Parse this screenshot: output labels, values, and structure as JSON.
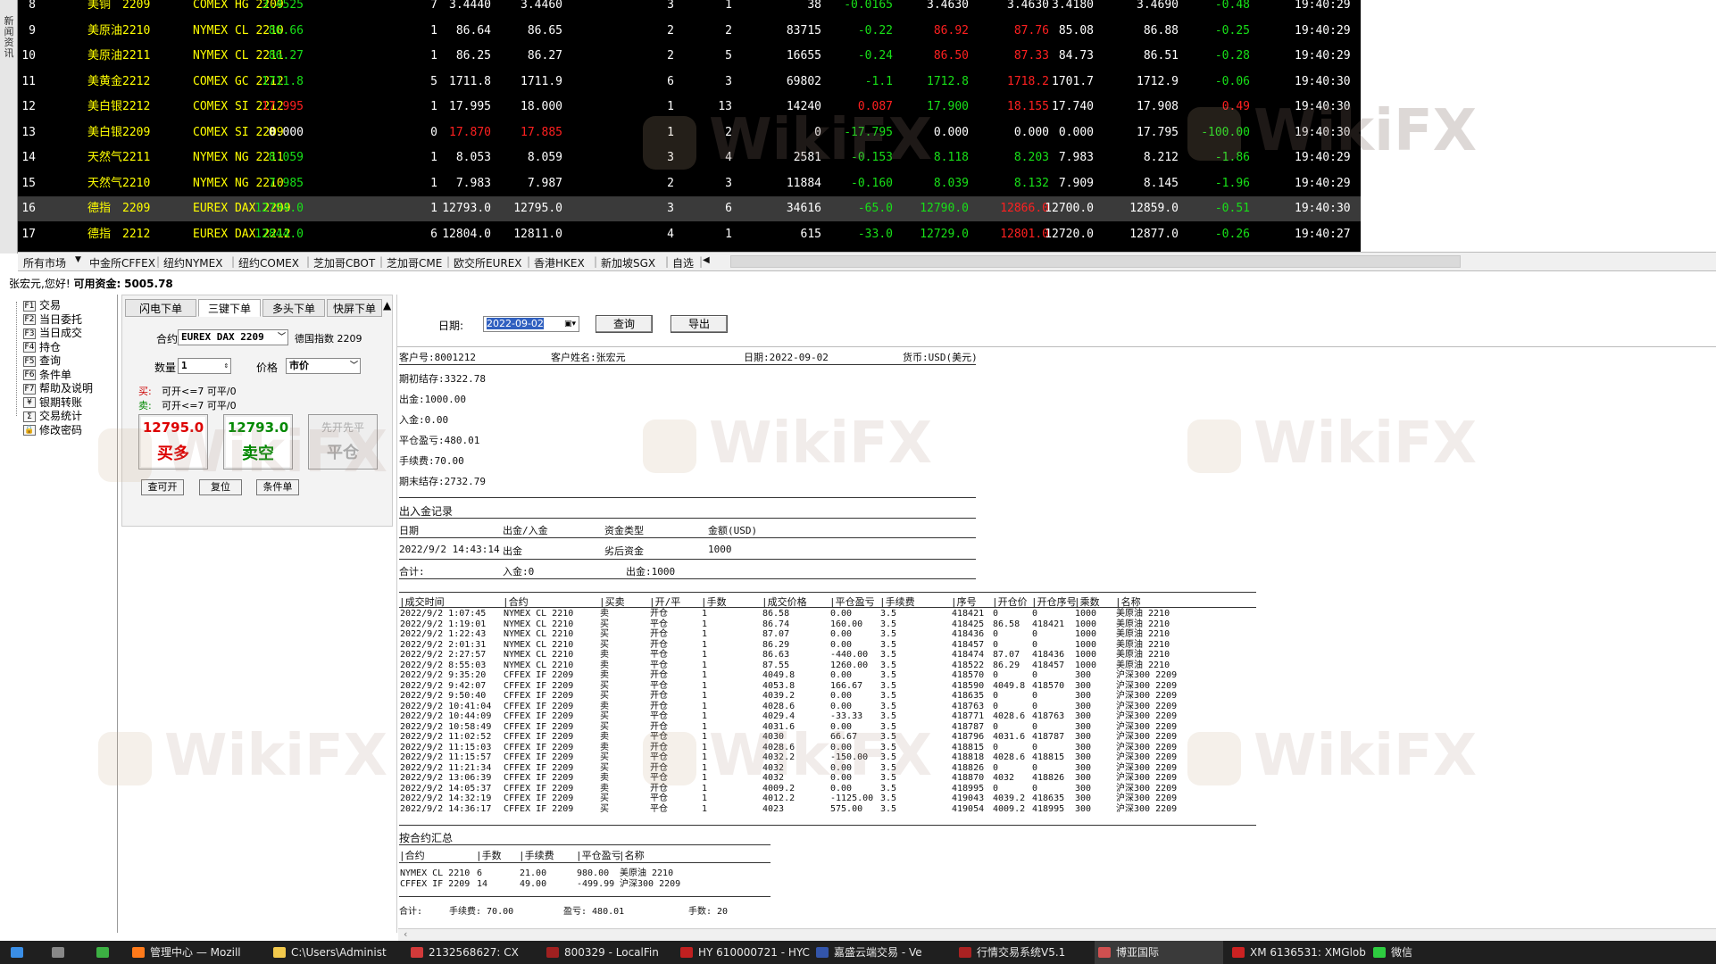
{
  "side_strip": {
    "label": "新闻资讯"
  },
  "quotes": [
    {
      "no": "8",
      "name": "美铜",
      "month": "2209",
      "contract": "COMEX HG 2209",
      "last": "3.4525",
      "lastc": "c-g",
      "vol": "7",
      "bid": "3.4440",
      "ask": "3.4460",
      "bidv": "3",
      "askv": "1",
      "tvol": "38",
      "chg": "-0.0165",
      "chgc": "c-g",
      "open": "3.4630",
      "openc": "c-w",
      "high": "3.4630",
      "highc": "c-w",
      "low": "3.4180",
      "pre": "3.4690",
      "pct": "-0.48",
      "pctc": "c-g",
      "time": "19:40:29"
    },
    {
      "no": "9",
      "name": "美原油",
      "month": "2210",
      "contract": "NYMEX CL 2210",
      "last": "86.66",
      "lastc": "c-g",
      "vol": "1",
      "bid": "86.64",
      "ask": "86.65",
      "bidv": "2",
      "askv": "2",
      "tvol": "83715",
      "chg": "-0.22",
      "chgc": "c-g",
      "open": "86.92",
      "openc": "c-r",
      "high": "87.76",
      "highc": "c-r",
      "low": "85.08",
      "pre": "86.88",
      "pct": "-0.25",
      "pctc": "c-g",
      "time": "19:40:29"
    },
    {
      "no": "10",
      "name": "美原油",
      "month": "2211",
      "contract": "NYMEX CL 2211",
      "last": "86.27",
      "lastc": "c-g",
      "vol": "1",
      "bid": "86.25",
      "ask": "86.27",
      "bidv": "2",
      "askv": "5",
      "tvol": "16655",
      "chg": "-0.24",
      "chgc": "c-g",
      "open": "86.50",
      "openc": "c-r",
      "high": "87.33",
      "highc": "c-r",
      "low": "84.73",
      "pre": "86.51",
      "pct": "-0.28",
      "pctc": "c-g",
      "time": "19:40:29"
    },
    {
      "no": "11",
      "name": "美黄金",
      "month": "2212",
      "contract": "COMEX GC 2212",
      "last": "1711.8",
      "lastc": "c-g",
      "vol": "5",
      "bid": "1711.8",
      "ask": "1711.9",
      "bidv": "6",
      "askv": "3",
      "tvol": "69802",
      "chg": "-1.1",
      "chgc": "c-g",
      "open": "1712.8",
      "openc": "c-g",
      "high": "1718.2",
      "highc": "c-r",
      "low": "1701.7",
      "pre": "1712.9",
      "pct": "-0.06",
      "pctc": "c-g",
      "time": "19:40:30"
    },
    {
      "no": "12",
      "name": "美白银",
      "month": "2212",
      "contract": "COMEX SI 2212",
      "last": "17.995",
      "lastc": "c-r",
      "vol": "1",
      "bid": "17.995",
      "ask": "18.000",
      "bidv": "1",
      "askv": "13",
      "tvol": "14240",
      "chg": "0.087",
      "chgc": "c-r",
      "open": "17.900",
      "openc": "c-g",
      "high": "18.155",
      "highc": "c-r",
      "low": "17.740",
      "pre": "17.908",
      "pct": "0.49",
      "pctc": "c-r",
      "time": "19:40:30"
    },
    {
      "no": "13",
      "name": "美白银",
      "month": "2209",
      "contract": "COMEX SI 2209",
      "last": "0.000",
      "lastc": "c-w",
      "vol": "0",
      "bid": "17.870",
      "ask": "17.885",
      "bidv": "1",
      "askv": "2",
      "tvol": "0",
      "chg": "-17.795",
      "chgc": "c-g",
      "open": "0.000",
      "openc": "c-w",
      "high": "0.000",
      "highc": "c-w",
      "low": "0.000",
      "pre": "17.795",
      "pct": "-100.00",
      "pctc": "c-g",
      "time": "19:40:30",
      "redbid": true
    },
    {
      "no": "14",
      "name": "天然气",
      "month": "2211",
      "contract": "NYMEX NG 2211",
      "last": "8.059",
      "lastc": "c-g",
      "vol": "1",
      "bid": "8.053",
      "ask": "8.059",
      "bidv": "3",
      "askv": "4",
      "tvol": "2581",
      "chg": "-0.153",
      "chgc": "c-g",
      "open": "8.118",
      "openc": "c-g",
      "high": "8.203",
      "highc": "c-g",
      "low": "7.983",
      "pre": "8.212",
      "pct": "-1.86",
      "pctc": "c-g",
      "time": "19:40:29"
    },
    {
      "no": "15",
      "name": "天然气",
      "month": "2210",
      "contract": "NYMEX NG 2210",
      "last": "7.985",
      "lastc": "c-g",
      "vol": "1",
      "bid": "7.983",
      "ask": "7.987",
      "bidv": "2",
      "askv": "3",
      "tvol": "11884",
      "chg": "-0.160",
      "chgc": "c-g",
      "open": "8.039",
      "openc": "c-g",
      "high": "8.132",
      "highc": "c-g",
      "low": "7.909",
      "pre": "8.145",
      "pct": "-1.96",
      "pctc": "c-g",
      "time": "19:40:29"
    },
    {
      "no": "16",
      "name": "德指",
      "month": "2209",
      "contract": "EUREX DAX 2209",
      "last": "12794.0",
      "lastc": "c-g",
      "vol": "1",
      "bid": "12793.0",
      "ask": "12795.0",
      "bidv": "3",
      "askv": "6",
      "tvol": "34616",
      "chg": "-65.0",
      "chgc": "c-g",
      "open": "12790.0",
      "openc": "c-g",
      "high": "12866.0",
      "highc": "c-r",
      "low": "12700.0",
      "pre": "12859.0",
      "pct": "-0.51",
      "pctc": "c-g",
      "time": "19:40:30",
      "sel": true
    },
    {
      "no": "17",
      "name": "德指",
      "month": "2212",
      "contract": "EUREX DAX 2212",
      "last": "12844.0",
      "lastc": "c-g",
      "vol": "6",
      "bid": "12804.0",
      "ask": "12811.0",
      "bidv": "4",
      "askv": "1",
      "tvol": "615",
      "chg": "-33.0",
      "chgc": "c-g",
      "open": "12729.0",
      "openc": "c-g",
      "high": "12801.0",
      "highc": "c-r",
      "low": "12720.0",
      "pre": "12877.0",
      "pct": "-0.26",
      "pctc": "c-g",
      "time": "19:40:27"
    }
  ],
  "market_tabs": [
    "所有市场",
    "中金所CFFEX",
    "纽约NYMEX",
    "纽约COMEX",
    "芝加哥CBOT",
    "芝加哥CME",
    "欧交所EUREX",
    "香港HKEX",
    "新加坡SGX",
    "自选"
  ],
  "account_bar": {
    "greeting": "张宏元,您好!",
    "funds_label": "可用资金:",
    "funds": "5005.78"
  },
  "nav": [
    {
      "key": "F1",
      "label": "交易"
    },
    {
      "key": "F2",
      "label": "当日委托"
    },
    {
      "key": "F3",
      "label": "当日成交"
    },
    {
      "key": "F4",
      "label": "持仓"
    },
    {
      "key": "F5",
      "label": "查询"
    },
    {
      "key": "F6",
      "label": "条件单"
    },
    {
      "key": "F7",
      "label": "帮助及说明"
    },
    {
      "key": "¥",
      "label": "银期转账"
    },
    {
      "key": "Σ",
      "label": "交易统计"
    },
    {
      "key": "🔒",
      "label": "修改密码"
    }
  ],
  "order": {
    "tabs": [
      "闪电下单",
      "三键下单",
      "多头下单",
      "快屏下单"
    ],
    "contract_label": "合约",
    "contract_value": "EUREX DAX 2209",
    "contract_name": "德国指数 2209",
    "qty_label": "数量",
    "qty_value": "1",
    "price_label": "价格",
    "price_value": "市价",
    "buy_tag": "买:",
    "buy_info": "可开<=7 可平/0",
    "sell_tag": "卖:",
    "sell_info": "可开<=7 可平/0",
    "buy_price": "12795.0",
    "buy_action": "买多",
    "sell_price": "12793.0",
    "sell_action": "卖空",
    "close_top": "先开先平",
    "close_action": "平仓",
    "btn_query": "查可开",
    "btn_reset": "复位",
    "btn_cond": "条件单"
  },
  "toolbar": {
    "date_label": "日期:",
    "date_value": "2022-09-02",
    "query": "查询",
    "export": "导出"
  },
  "statement": {
    "client_no": "客户号:8001212",
    "client_name": "客户姓名:张宏元",
    "date": "日期:2022-09-02",
    "currency": "货币:USD(美元)",
    "lines": [
      "期初结存:3322.78",
      "出金:1000.00",
      "入金:0.00",
      "平仓盈亏:480.01",
      "手续费:70.00",
      "期末结存:2732.79"
    ],
    "cash_title": "出入金记录",
    "cash_headers": [
      "日期",
      "出金/入金",
      "资金类型",
      "金额(USD)"
    ],
    "cash_row": [
      "2022/9/2 14:43:14",
      "出金",
      "劣后资金",
      "1000"
    ],
    "cash_total": [
      "合计:",
      "入金:0",
      "出金:1000"
    ],
    "trade_headers": [
      "|成交时间",
      "|合约",
      "|买卖",
      "|开/平",
      "|手数",
      "|成交价格",
      "|平仓盈亏",
      "|手续费",
      "|序号",
      "|开仓价",
      "|开仓序号",
      "|乘数",
      "|名称"
    ],
    "trades": [
      [
        "2022/9/2 1:07:45",
        "NYMEX CL 2210",
        "卖",
        "开仓",
        "1",
        "86.58",
        "0.00",
        "3.5",
        "418421",
        "0",
        "0",
        "1000",
        "美原油 2210"
      ],
      [
        "2022/9/2 1:19:01",
        "NYMEX CL 2210",
        "买",
        "平仓",
        "1",
        "86.74",
        "160.00",
        "3.5",
        "418425",
        "86.58",
        "418421",
        "1000",
        "美原油 2210"
      ],
      [
        "2022/9/2 1:22:43",
        "NYMEX CL 2210",
        "买",
        "开仓",
        "1",
        "87.07",
        "0.00",
        "3.5",
        "418436",
        "0",
        "0",
        "1000",
        "美原油 2210"
      ],
      [
        "2022/9/2 2:01:31",
        "NYMEX CL 2210",
        "买",
        "开仓",
        "1",
        "86.29",
        "0.00",
        "3.5",
        "418457",
        "0",
        "0",
        "1000",
        "美原油 2210"
      ],
      [
        "2022/9/2 2:27:57",
        "NYMEX CL 2210",
        "卖",
        "平仓",
        "1",
        "86.63",
        "-440.00",
        "3.5",
        "418474",
        "87.07",
        "418436",
        "1000",
        "美原油 2210"
      ],
      [
        "2022/9/2 8:55:03",
        "NYMEX CL 2210",
        "卖",
        "平仓",
        "1",
        "87.55",
        "1260.00",
        "3.5",
        "418522",
        "86.29",
        "418457",
        "1000",
        "美原油 2210"
      ],
      [
        "2022/9/2 9:35:20",
        "CFFEX IF 2209",
        "卖",
        "开仓",
        "1",
        "4049.8",
        "0.00",
        "3.5",
        "418570",
        "0",
        "0",
        "300",
        "沪深300 2209"
      ],
      [
        "2022/9/2 9:42:07",
        "CFFEX IF 2209",
        "买",
        "平仓",
        "1",
        "4053.8",
        "166.67",
        "3.5",
        "418590",
        "4049.8",
        "418570",
        "300",
        "沪深300 2209"
      ],
      [
        "2022/9/2 9:50:40",
        "CFFEX IF 2209",
        "买",
        "开仓",
        "1",
        "4039.2",
        "0.00",
        "3.5",
        "418635",
        "0",
        "0",
        "300",
        "沪深300 2209"
      ],
      [
        "2022/9/2 10:41:04",
        "CFFEX IF 2209",
        "卖",
        "开仓",
        "1",
        "4028.6",
        "0.00",
        "3.5",
        "418763",
        "0",
        "0",
        "300",
        "沪深300 2209"
      ],
      [
        "2022/9/2 10:44:09",
        "CFFEX IF 2209",
        "买",
        "平仓",
        "1",
        "4029.4",
        "-33.33",
        "3.5",
        "418771",
        "4028.6",
        "418763",
        "300",
        "沪深300 2209"
      ],
      [
        "2022/9/2 10:58:49",
        "CFFEX IF 2209",
        "买",
        "开仓",
        "1",
        "4031.6",
        "0.00",
        "3.5",
        "418787",
        "0",
        "0",
        "300",
        "沪深300 2209"
      ],
      [
        "2022/9/2 11:02:52",
        "CFFEX IF 2209",
        "卖",
        "平仓",
        "1",
        "4030",
        "66.67",
        "3.5",
        "418796",
        "4031.6",
        "418787",
        "300",
        "沪深300 2209"
      ],
      [
        "2022/9/2 11:15:03",
        "CFFEX IF 2209",
        "卖",
        "开仓",
        "1",
        "4028.6",
        "0.00",
        "3.5",
        "418815",
        "0",
        "0",
        "300",
        "沪深300 2209"
      ],
      [
        "2022/9/2 11:15:57",
        "CFFEX IF 2209",
        "买",
        "平仓",
        "1",
        "4032.2",
        "-150.00",
        "3.5",
        "418818",
        "4028.6",
        "418815",
        "300",
        "沪深300 2209"
      ],
      [
        "2022/9/2 11:21:34",
        "CFFEX IF 2209",
        "买",
        "开仓",
        "1",
        "4032",
        "0.00",
        "3.5",
        "418826",
        "0",
        "0",
        "300",
        "沪深300 2209"
      ],
      [
        "2022/9/2 13:06:39",
        "CFFEX IF 2209",
        "卖",
        "平仓",
        "1",
        "4032",
        "0.00",
        "3.5",
        "418870",
        "4032",
        "418826",
        "300",
        "沪深300 2209"
      ],
      [
        "2022/9/2 14:05:37",
        "CFFEX IF 2209",
        "卖",
        "开仓",
        "1",
        "4009.2",
        "0.00",
        "3.5",
        "418995",
        "0",
        "0",
        "300",
        "沪深300 2209"
      ],
      [
        "2022/9/2 14:32:19",
        "CFFEX IF 2209",
        "买",
        "平仓",
        "1",
        "4012.2",
        "-1125.00",
        "3.5",
        "419043",
        "4039.2",
        "418635",
        "300",
        "沪深300 2209"
      ],
      [
        "2022/9/2 14:36:17",
        "CFFEX IF 2209",
        "买",
        "平仓",
        "1",
        "4023",
        "575.00",
        "3.5",
        "419054",
        "4009.2",
        "418995",
        "300",
        "沪深300 2209"
      ]
    ],
    "summary_title": "按合约汇总",
    "summary_headers": [
      "|合约",
      "|手数",
      "|手续费",
      "|平仓盈亏",
      "|名称"
    ],
    "summary_rows": [
      [
        "NYMEX CL 2210",
        "6",
        "21.00",
        "980.00",
        "美原油 2210"
      ],
      [
        "CFFEX IF 2209",
        "14",
        "49.00",
        "-499.99",
        "沪深300 2209"
      ]
    ],
    "summary_total": [
      "合计:",
      "手续费: 70.00",
      "盈亏: 480.01",
      "手数: 20"
    ]
  },
  "watermark": "WikiFX",
  "taskbar": [
    {
      "label": "",
      "color": "#3a8ee6"
    },
    {
      "label": "",
      "color": "#888"
    },
    {
      "label": "",
      "color": "#3cb043"
    },
    {
      "label": "管理中心 — Mozill",
      "color": "#ff7a1a"
    },
    {
      "label": "C:\\Users\\Administ",
      "color": "#f2c94c"
    },
    {
      "label": "2132568627: CX",
      "color": "#d23a3a"
    },
    {
      "label": "800329 - LocalFin",
      "color": "#a02020"
    },
    {
      "label": "HY 610000721 - HYC",
      "color": "#c02020"
    },
    {
      "label": "嘉盛云端交易 - Ve",
      "color": "#3355aa"
    },
    {
      "label": "行情交易系统V5.1",
      "color": "#aa2222"
    },
    {
      "label": "博亚国际",
      "color": "#d05050"
    },
    {
      "label": "XM 6136531: XMGlob",
      "color": "#cc2222"
    },
    {
      "label": "微信",
      "color": "#2ecc40"
    }
  ]
}
